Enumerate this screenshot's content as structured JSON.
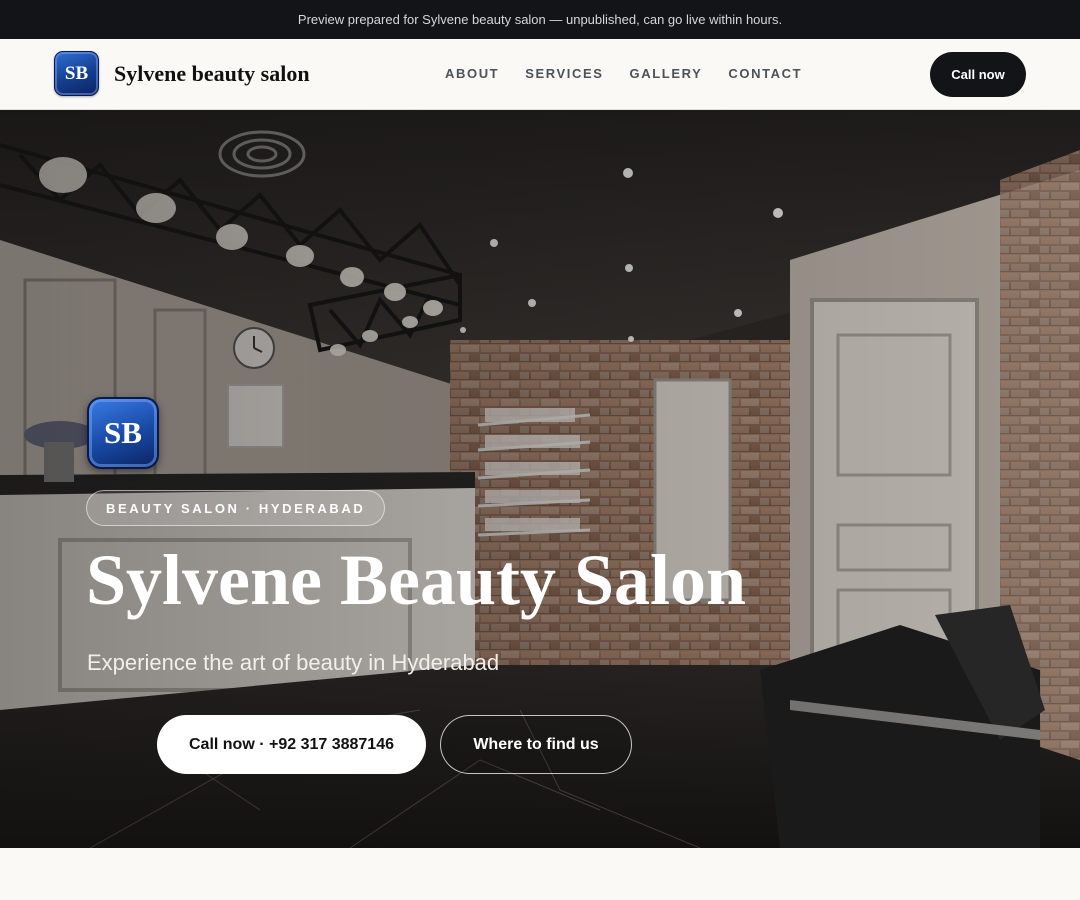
{
  "preview_banner": {
    "text": "Preview prepared for Sylvene beauty salon — unpublished, can go live within hours."
  },
  "header": {
    "logo_initials": "SB",
    "brand_name": "Sylvene beauty salon",
    "nav": [
      {
        "label": "ABOUT"
      },
      {
        "label": "SERVICES"
      },
      {
        "label": "GALLERY"
      },
      {
        "label": "CONTACT"
      }
    ],
    "cta_label": "Call now"
  },
  "hero": {
    "logo_initials": "SB",
    "tagline": "BEAUTY SALON · HYDERABAD",
    "title": "Sylvene Beauty Salon",
    "subtitle": "Experience the art of beauty in Hyderabad",
    "primary_button": "Call now · +92 317 3887146",
    "secondary_button": "Where to find us"
  },
  "colors": {
    "banner_bg": "#121418",
    "nav_cta_bg": "#131418",
    "logo_blue": "#1848a3",
    "page_bg": "#faf9f6"
  }
}
